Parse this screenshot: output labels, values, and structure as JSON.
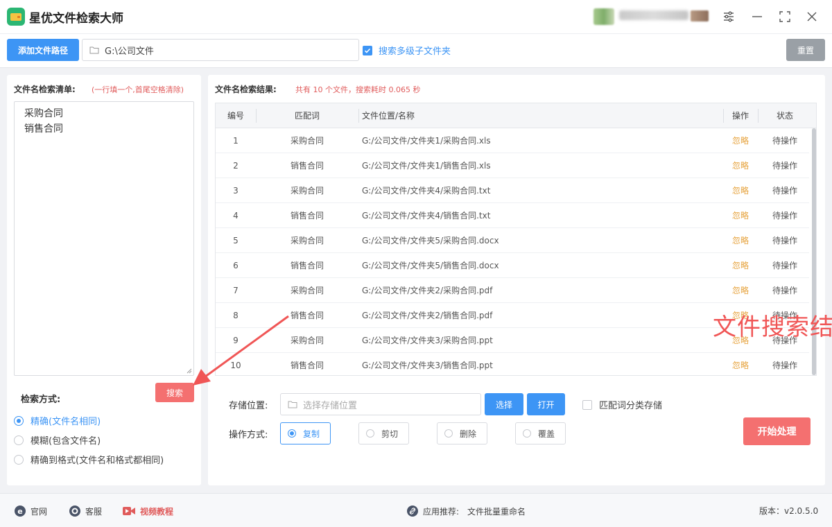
{
  "app": {
    "title": "星优文件检索大师"
  },
  "toolbar": {
    "add_path_label": "添加文件路径",
    "path_value": "G:\\公司文件",
    "subfolder_label": "搜索多级子文件夹",
    "subfolder_checked": true,
    "reset_label": "重置"
  },
  "left": {
    "title": "文件名检索清单:",
    "hint": "(一行填一个,首尾空格清除)",
    "names": [
      "采购合同",
      "销售合同"
    ],
    "search_label": "搜索",
    "mode_title": "检索方式:",
    "modes": [
      {
        "label": "精确(文件名相同)",
        "selected": true
      },
      {
        "label": "模糊(包含文件名)",
        "selected": false
      },
      {
        "label": "精确到格式(文件名和格式都相同)",
        "selected": false
      }
    ]
  },
  "results": {
    "title": "文件名检索结果:",
    "summary": "共有 10 个文件，搜索耗时 0.065 秒",
    "headers": {
      "num": "编号",
      "word": "匹配词",
      "path": "文件位置/名称",
      "op": "操作",
      "status": "状态"
    },
    "rows": [
      {
        "num": "1",
        "word": "采购合同",
        "path": "G:/公司文件/文件夹1/采购合同.xls",
        "op": "忽略",
        "status": "待操作"
      },
      {
        "num": "2",
        "word": "销售合同",
        "path": "G:/公司文件/文件夹1/销售合同.xls",
        "op": "忽略",
        "status": "待操作"
      },
      {
        "num": "3",
        "word": "采购合同",
        "path": "G:/公司文件/文件夹4/采购合同.txt",
        "op": "忽略",
        "status": "待操作"
      },
      {
        "num": "4",
        "word": "销售合同",
        "path": "G:/公司文件/文件夹4/销售合同.txt",
        "op": "忽略",
        "status": "待操作"
      },
      {
        "num": "5",
        "word": "采购合同",
        "path": "G:/公司文件/文件夹5/采购合同.docx",
        "op": "忽略",
        "status": "待操作"
      },
      {
        "num": "6",
        "word": "销售合同",
        "path": "G:/公司文件/文件夹5/销售合同.docx",
        "op": "忽略",
        "status": "待操作"
      },
      {
        "num": "7",
        "word": "采购合同",
        "path": "G:/公司文件/文件夹2/采购合同.pdf",
        "op": "忽略",
        "status": "待操作"
      },
      {
        "num": "8",
        "word": "销售合同",
        "path": "G:/公司文件/文件夹2/销售合同.pdf",
        "op": "忽略",
        "status": "待操作"
      },
      {
        "num": "9",
        "word": "采购合同",
        "path": "G:/公司文件/文件夹3/采购合同.ppt",
        "op": "忽略",
        "status": "待操作"
      },
      {
        "num": "10",
        "word": "销售合同",
        "path": "G:/公司文件/文件夹3/销售合同.ppt",
        "op": "忽略",
        "status": "待操作"
      }
    ],
    "overlay": "文件搜索结果"
  },
  "storage": {
    "label": "存储位置:",
    "placeholder": "选择存储位置",
    "choose_label": "选择",
    "open_label": "打开",
    "classify_label": "匹配词分类存储",
    "classify_checked": false
  },
  "operation": {
    "label": "操作方式:",
    "options": [
      {
        "label": "复制",
        "selected": true
      },
      {
        "label": "剪切",
        "selected": false
      },
      {
        "label": "删除",
        "selected": false
      },
      {
        "label": "覆盖",
        "selected": false
      }
    ],
    "start_label": "开始处理"
  },
  "footer": {
    "website": "官网",
    "service": "客服",
    "video": "视频教程",
    "recommend_prefix": "应用推荐:",
    "recommend_app": "文件批量重命名",
    "version": "版本：v2.0.5.0"
  },
  "colors": {
    "accent": "#3d95f5",
    "danger": "#f47070",
    "warning": "#e6a23c"
  }
}
